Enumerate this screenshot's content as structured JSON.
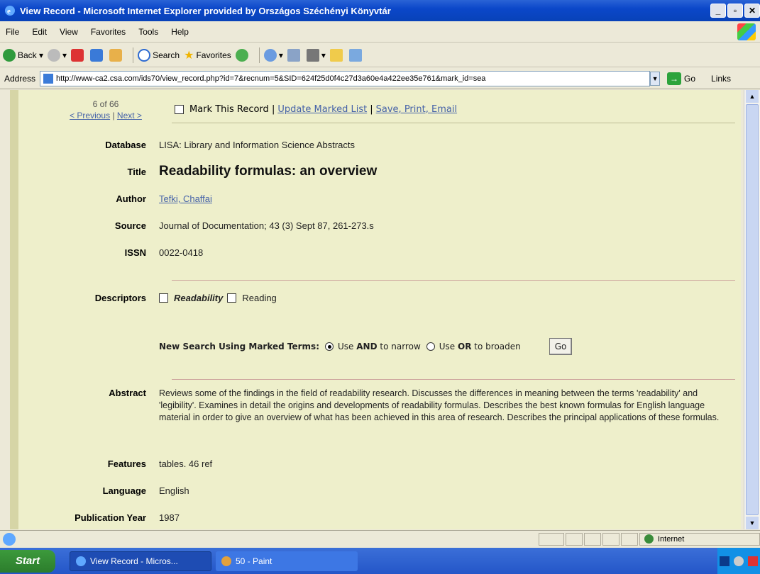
{
  "window": {
    "title": "View Record - Microsoft Internet Explorer provided by Országos Széchényi Könyvtár"
  },
  "menu": [
    "File",
    "Edit",
    "View",
    "Favorites",
    "Tools",
    "Help"
  ],
  "toolbar": {
    "back": "Back",
    "search": "Search",
    "favorites": "Favorites"
  },
  "address": {
    "label": "Address",
    "url": "http://www-ca2.csa.com/ids70/view_record.php?id=7&recnum=5&SID=624f25d0f4c27d3a60e4a422ee35e761&mark_id=sea",
    "go": "Go",
    "links": "Links"
  },
  "record": {
    "count": "6 of 66",
    "previous": "< Previous",
    "next": "Next >",
    "mark_label": "Mark This Record",
    "update_link": "Update Marked List",
    "save_link": "Save, Print, Email",
    "database_label": "Database",
    "database": "LISA: Library and Information Science Abstracts",
    "title_label": "Title",
    "title": "Readability formulas: an overview",
    "author_label": "Author",
    "author": "Tefki, Chaffai",
    "source_label": "Source",
    "source": "Journal of Documentation; 43 (3) Sept 87, 261-273.s",
    "issn_label": "ISSN",
    "issn": "0022-0418",
    "descriptors_label": "Descriptors",
    "descriptor1": "Readability",
    "descriptor2": "Reading",
    "new_search_label": "New Search Using Marked Terms:",
    "use": "Use",
    "and_kw": "AND",
    "and_suffix": "to narrow",
    "or_kw": "OR",
    "or_suffix": "to broaden",
    "go_button": "Go",
    "abstract_label": "Abstract",
    "abstract": "Reviews some of the findings in the field of readability research. Discusses the differences in meaning between the terms 'readability' and 'legibility'. Examines in detail the origins and developments of readability formulas. Describes the best known formulas for English language material in order to give an overview of what has been achieved in this area of research. Describes the principal applications of these formulas.",
    "features_label": "Features",
    "features": "tables. 46 ref",
    "language_label": "Language",
    "language": "English",
    "pubyear_label": "Publication Year",
    "pubyear": "1987"
  },
  "status": {
    "zone": "Internet"
  },
  "taskbar": {
    "start": "Start",
    "task1": "View Record - Micros...",
    "task2": "50 - Paint"
  }
}
